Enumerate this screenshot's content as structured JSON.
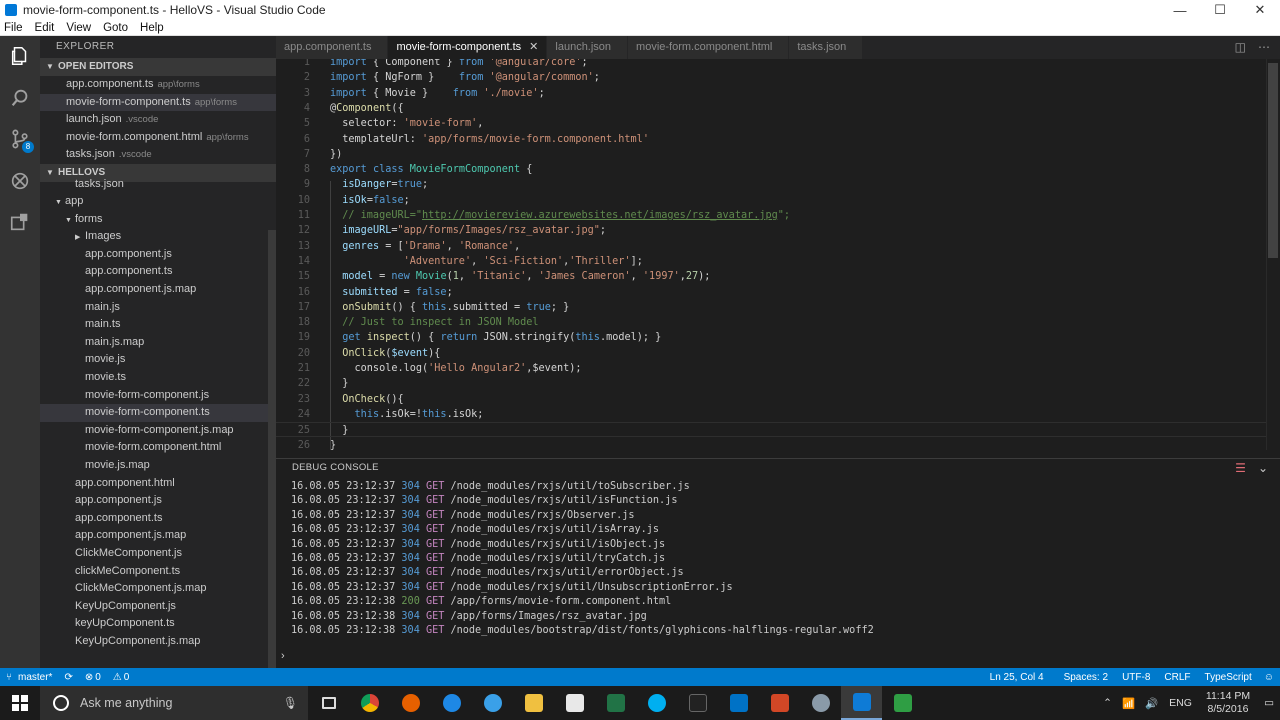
{
  "window": {
    "title": "movie-form-component.ts - HelloVS - Visual Studio Code",
    "minimize": "—",
    "maximize": "☐",
    "close": "✕"
  },
  "menu": [
    "File",
    "Edit",
    "View",
    "Goto",
    "Help"
  ],
  "activity": {
    "git_badge": "8"
  },
  "sidebar": {
    "title": "EXPLORER",
    "open_editors_label": "OPEN EDITORS",
    "open_editors": [
      {
        "name": "app.component.ts",
        "desc": "app\\forms"
      },
      {
        "name": "movie-form-component.ts",
        "desc": "app\\forms",
        "active": true
      },
      {
        "name": "launch.json",
        "desc": ".vscode"
      },
      {
        "name": "movie-form.component.html",
        "desc": "app\\forms"
      },
      {
        "name": "tasks.json",
        "desc": ".vscode"
      }
    ],
    "project_label": "HELLOVS",
    "tree": [
      {
        "name": "tasks.json",
        "depth": 2
      },
      {
        "name": "app",
        "depth": 1,
        "folder": "open"
      },
      {
        "name": "forms",
        "depth": 2,
        "folder": "open"
      },
      {
        "name": "Images",
        "depth": 3,
        "folder": "closed"
      },
      {
        "name": "app.component.js",
        "depth": 3
      },
      {
        "name": "app.component.ts",
        "depth": 3
      },
      {
        "name": "app.component.js.map",
        "depth": 3
      },
      {
        "name": "main.js",
        "depth": 3
      },
      {
        "name": "main.ts",
        "depth": 3
      },
      {
        "name": "main.js.map",
        "depth": 3
      },
      {
        "name": "movie.js",
        "depth": 3
      },
      {
        "name": "movie.ts",
        "depth": 3
      },
      {
        "name": "movie-form-component.js",
        "depth": 3
      },
      {
        "name": "movie-form-component.ts",
        "depth": 3,
        "active": true
      },
      {
        "name": "movie-form-component.js.map",
        "depth": 3
      },
      {
        "name": "movie-form.component.html",
        "depth": 3
      },
      {
        "name": "movie.js.map",
        "depth": 3
      },
      {
        "name": "app.component.html",
        "depth": 2
      },
      {
        "name": "app.component.js",
        "depth": 2
      },
      {
        "name": "app.component.ts",
        "depth": 2
      },
      {
        "name": "app.component.js.map",
        "depth": 2
      },
      {
        "name": "ClickMeComponent.js",
        "depth": 2
      },
      {
        "name": "clickMeComponent.ts",
        "depth": 2
      },
      {
        "name": "ClickMeComponent.js.map",
        "depth": 2
      },
      {
        "name": "KeyUpComponent.js",
        "depth": 2
      },
      {
        "name": "keyUpComponent.ts",
        "depth": 2
      },
      {
        "name": "KeyUpComponent.js.map",
        "depth": 2
      }
    ]
  },
  "tabs": [
    {
      "label": "app.component.ts"
    },
    {
      "label": "movie-form-component.ts",
      "active": true
    },
    {
      "label": "launch.json"
    },
    {
      "label": "movie-form.component.html"
    },
    {
      "label": "tasks.json"
    }
  ],
  "tab_close": "✕",
  "editor": {
    "lines": [
      {
        "n": 1,
        "tokens": [
          [
            "k",
            "import"
          ],
          [
            "p",
            " { Component } "
          ],
          [
            "k",
            "from"
          ],
          [
            "p",
            " "
          ],
          [
            "s",
            "'@angular/core'"
          ],
          [
            "p",
            ";"
          ]
        ]
      },
      {
        "n": 2,
        "tokens": [
          [
            "k",
            "import"
          ],
          [
            "p",
            " { NgForm }    "
          ],
          [
            "k",
            "from"
          ],
          [
            "p",
            " "
          ],
          [
            "s",
            "'@angular/common'"
          ],
          [
            "p",
            ";"
          ]
        ]
      },
      {
        "n": 3,
        "tokens": [
          [
            "k",
            "import"
          ],
          [
            "p",
            " { Movie }    "
          ],
          [
            "k",
            "from"
          ],
          [
            "p",
            " "
          ],
          [
            "s",
            "'./movie'"
          ],
          [
            "p",
            ";"
          ]
        ]
      },
      {
        "n": 4,
        "tokens": [
          [
            "p",
            "@"
          ],
          [
            "f",
            "Component"
          ],
          [
            "p",
            "({"
          ]
        ]
      },
      {
        "n": 5,
        "tokens": [
          [
            "p",
            "  selector: "
          ],
          [
            "s",
            "'movie-form'"
          ],
          [
            "p",
            ","
          ]
        ]
      },
      {
        "n": 6,
        "tokens": [
          [
            "p",
            "  templateUrl: "
          ],
          [
            "s",
            "'app/forms/movie-form.component.html'"
          ]
        ]
      },
      {
        "n": 7,
        "tokens": [
          [
            "p",
            "})"
          ]
        ]
      },
      {
        "n": 8,
        "tokens": [
          [
            "k",
            "export"
          ],
          [
            "p",
            " "
          ],
          [
            "k",
            "class"
          ],
          [
            "p",
            " "
          ],
          [
            "t",
            "MovieFormComponent"
          ],
          [
            "p",
            " {"
          ]
        ]
      },
      {
        "n": 9,
        "tokens": [
          [
            "p",
            "  "
          ],
          [
            "v",
            "isDanger"
          ],
          [
            "p",
            "="
          ],
          [
            "k",
            "true"
          ],
          [
            "p",
            ";"
          ]
        ]
      },
      {
        "n": 10,
        "tokens": [
          [
            "p",
            "  "
          ],
          [
            "v",
            "isOk"
          ],
          [
            "p",
            "="
          ],
          [
            "k",
            "false"
          ],
          [
            "p",
            ";"
          ]
        ]
      },
      {
        "n": 11,
        "tokens": [
          [
            "c",
            "  // imageURL=\""
          ],
          [
            "u",
            "http://moviereview.azurewebsites.net/images/rsz_avatar.jpg"
          ],
          [
            "c",
            "\";"
          ]
        ]
      },
      {
        "n": 12,
        "tokens": [
          [
            "p",
            "  "
          ],
          [
            "v",
            "imageURL"
          ],
          [
            "p",
            "="
          ],
          [
            "s",
            "\"app/forms/Images/rsz_avatar.jpg\""
          ],
          [
            "p",
            ";"
          ]
        ]
      },
      {
        "n": 13,
        "tokens": [
          [
            "p",
            "  "
          ],
          [
            "v",
            "genres"
          ],
          [
            "p",
            " = ["
          ],
          [
            "s",
            "'Drama'"
          ],
          [
            "p",
            ", "
          ],
          [
            "s",
            "'Romance'"
          ],
          [
            "p",
            ","
          ]
        ]
      },
      {
        "n": 14,
        "tokens": [
          [
            "p",
            "            "
          ],
          [
            "s",
            "'Adventure'"
          ],
          [
            "p",
            ", "
          ],
          [
            "s",
            "'Sci-Fiction'"
          ],
          [
            "p",
            ","
          ],
          [
            "s",
            "'Thriller'"
          ],
          [
            "p",
            "];"
          ]
        ]
      },
      {
        "n": 15,
        "tokens": [
          [
            "p",
            "  "
          ],
          [
            "v",
            "model"
          ],
          [
            "p",
            " = "
          ],
          [
            "k",
            "new"
          ],
          [
            "p",
            " "
          ],
          [
            "t",
            "Movie"
          ],
          [
            "p",
            "("
          ],
          [
            "n",
            "1"
          ],
          [
            "p",
            ", "
          ],
          [
            "s",
            "'Titanic'"
          ],
          [
            "p",
            ", "
          ],
          [
            "s",
            "'James Cameron'"
          ],
          [
            "p",
            ", "
          ],
          [
            "s",
            "'1997'"
          ],
          [
            "p",
            ","
          ],
          [
            "n",
            "27"
          ],
          [
            "p",
            ");"
          ]
        ]
      },
      {
        "n": 16,
        "tokens": [
          [
            "p",
            "  "
          ],
          [
            "v",
            "submitted"
          ],
          [
            "p",
            " = "
          ],
          [
            "k",
            "false"
          ],
          [
            "p",
            ";"
          ]
        ]
      },
      {
        "n": 17,
        "tokens": [
          [
            "p",
            "  "
          ],
          [
            "f",
            "onSubmit"
          ],
          [
            "p",
            "() { "
          ],
          [
            "k",
            "this"
          ],
          [
            "p",
            ".submitted = "
          ],
          [
            "k",
            "true"
          ],
          [
            "p",
            "; }"
          ]
        ]
      },
      {
        "n": 18,
        "tokens": [
          [
            "c",
            "  // Just to inspect in JSON Model"
          ]
        ]
      },
      {
        "n": 19,
        "tokens": [
          [
            "p",
            "  "
          ],
          [
            "k",
            "get"
          ],
          [
            "p",
            " "
          ],
          [
            "f",
            "inspect"
          ],
          [
            "p",
            "() { "
          ],
          [
            "k",
            "return"
          ],
          [
            "p",
            " JSON.stringify("
          ],
          [
            "k",
            "this"
          ],
          [
            "p",
            ".model); }"
          ]
        ]
      },
      {
        "n": 20,
        "tokens": [
          [
            "p",
            "  "
          ],
          [
            "f",
            "OnClick"
          ],
          [
            "p",
            "("
          ],
          [
            "v",
            "$event"
          ],
          [
            "p",
            "){"
          ]
        ]
      },
      {
        "n": 21,
        "tokens": [
          [
            "p",
            "    console.log("
          ],
          [
            "s",
            "'Hello Angular2'"
          ],
          [
            "p",
            ",$event);"
          ]
        ]
      },
      {
        "n": 22,
        "tokens": [
          [
            "p",
            "  }"
          ]
        ]
      },
      {
        "n": 23,
        "tokens": [
          [
            "p",
            "  "
          ],
          [
            "f",
            "OnCheck"
          ],
          [
            "p",
            "(){"
          ]
        ]
      },
      {
        "n": 24,
        "tokens": [
          [
            "p",
            "    "
          ],
          [
            "k",
            "this"
          ],
          [
            "p",
            ".isOk=!"
          ],
          [
            "k",
            "this"
          ],
          [
            "p",
            ".isOk;"
          ]
        ]
      },
      {
        "n": 25,
        "tokens": [
          [
            "p",
            "  }"
          ]
        ],
        "current": true
      },
      {
        "n": 26,
        "tokens": [
          [
            "p",
            "}"
          ]
        ]
      }
    ]
  },
  "panel": {
    "title": "DEBUG CONSOLE",
    "prompt": "›",
    "lines": [
      {
        "ts": "16.08.05 23:12:37",
        "status": "304",
        "method": "GET",
        "path": "/node_modules/rxjs/util/toSubscriber.js"
      },
      {
        "ts": "16.08.05 23:12:37",
        "status": "304",
        "method": "GET",
        "path": "/node_modules/rxjs/util/isFunction.js"
      },
      {
        "ts": "16.08.05 23:12:37",
        "status": "304",
        "method": "GET",
        "path": "/node_modules/rxjs/Observer.js"
      },
      {
        "ts": "16.08.05 23:12:37",
        "status": "304",
        "method": "GET",
        "path": "/node_modules/rxjs/util/isArray.js"
      },
      {
        "ts": "16.08.05 23:12:37",
        "status": "304",
        "method": "GET",
        "path": "/node_modules/rxjs/util/isObject.js"
      },
      {
        "ts": "16.08.05 23:12:37",
        "status": "304",
        "method": "GET",
        "path": "/node_modules/rxjs/util/tryCatch.js"
      },
      {
        "ts": "16.08.05 23:12:37",
        "status": "304",
        "method": "GET",
        "path": "/node_modules/rxjs/util/errorObject.js"
      },
      {
        "ts": "16.08.05 23:12:37",
        "status": "304",
        "method": "GET",
        "path": "/node_modules/rxjs/util/UnsubscriptionError.js"
      },
      {
        "ts": "16.08.05 23:12:38",
        "status": "200",
        "method": "GET",
        "path": "/app/forms/movie-form.component.html"
      },
      {
        "ts": "16.08.05 23:12:38",
        "status": "304",
        "method": "GET",
        "path": "/app/forms/Images/rsz_avatar.jpg"
      },
      {
        "ts": "16.08.05 23:12:38",
        "status": "304",
        "method": "GET",
        "path": "/node_modules/bootstrap/dist/fonts/glyphicons-halflings-regular.woff2"
      }
    ]
  },
  "status": {
    "branch": "master*",
    "errors": "0",
    "warnings": "0",
    "position": "Ln 25, Col 4",
    "spaces": "Spaces: 2",
    "encoding": "UTF-8",
    "eol": "CRLF",
    "language": "TypeScript",
    "smiley": "☺"
  },
  "taskbar": {
    "search_placeholder": "Ask me anything",
    "lang": "ENG",
    "time": "11:14 PM",
    "date": "8/5/2016"
  },
  "colors": {
    "accent": "#007acc",
    "editor_bg": "#1e1e1e",
    "sidebar_bg": "#252526",
    "activity_bg": "#333333"
  }
}
